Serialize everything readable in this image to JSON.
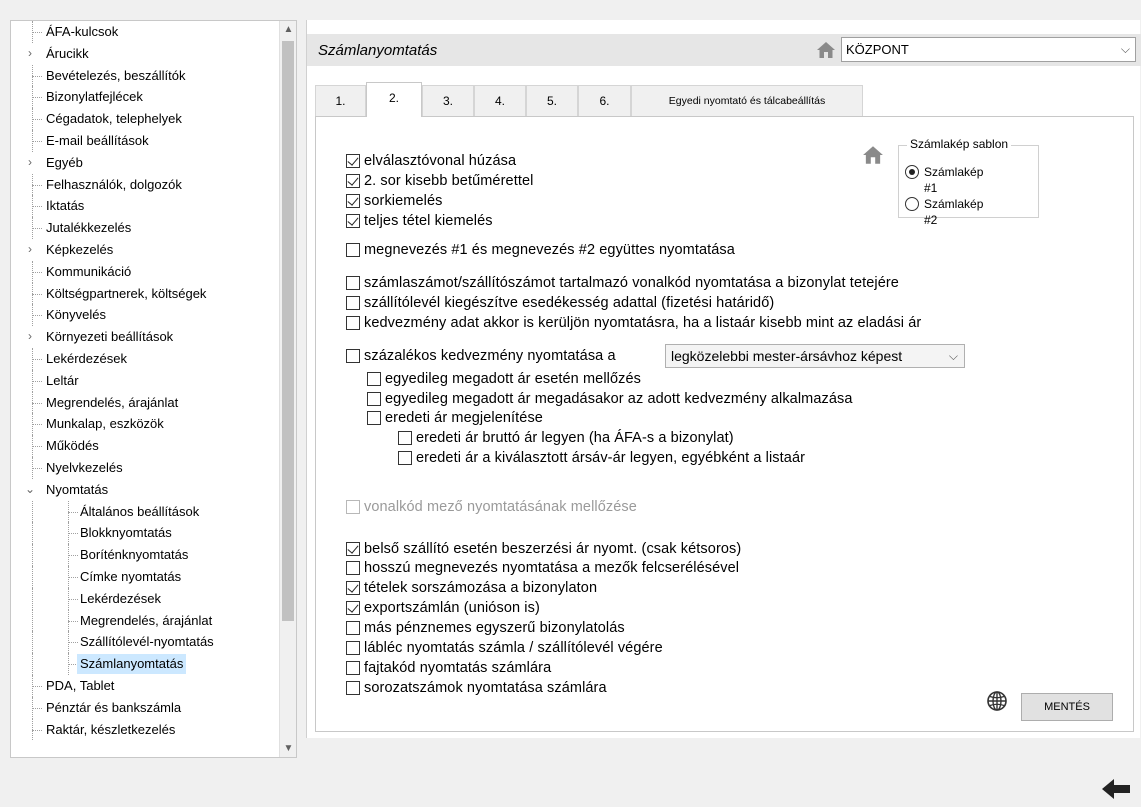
{
  "tree": {
    "items": [
      {
        "label": "ÁFA-kulcsok",
        "level": 0,
        "expander": ""
      },
      {
        "label": "Árucikk",
        "level": 0,
        "expander": "›"
      },
      {
        "label": "Bevételezés, beszállítók",
        "level": 0,
        "expander": ""
      },
      {
        "label": "Bizonylatfejlécek",
        "level": 0,
        "expander": ""
      },
      {
        "label": "Cégadatok, telephelyek",
        "level": 0,
        "expander": ""
      },
      {
        "label": "E-mail beállítások",
        "level": 0,
        "expander": ""
      },
      {
        "label": "Egyéb",
        "level": 0,
        "expander": "›"
      },
      {
        "label": "Felhasználók, dolgozók",
        "level": 0,
        "expander": ""
      },
      {
        "label": "Iktatás",
        "level": 0,
        "expander": ""
      },
      {
        "label": "Jutalékkezelés",
        "level": 0,
        "expander": ""
      },
      {
        "label": "Képkezelés",
        "level": 0,
        "expander": "›"
      },
      {
        "label": "Kommunikáció",
        "level": 0,
        "expander": ""
      },
      {
        "label": "Költségpartnerek, költségek",
        "level": 0,
        "expander": ""
      },
      {
        "label": "Könyvelés",
        "level": 0,
        "expander": ""
      },
      {
        "label": "Környezeti beállítások",
        "level": 0,
        "expander": "›"
      },
      {
        "label": "Lekérdezések",
        "level": 0,
        "expander": ""
      },
      {
        "label": "Leltár",
        "level": 0,
        "expander": ""
      },
      {
        "label": "Megrendelés, árajánlat",
        "level": 0,
        "expander": ""
      },
      {
        "label": "Munkalap, eszközök",
        "level": 0,
        "expander": ""
      },
      {
        "label": "Működés",
        "level": 0,
        "expander": ""
      },
      {
        "label": "Nyelvkezelés",
        "level": 0,
        "expander": ""
      },
      {
        "label": "Nyomtatás",
        "level": 0,
        "expander": "⌄"
      },
      {
        "label": "Általános beállítások",
        "level": 1,
        "expander": ""
      },
      {
        "label": "Blokknyomtatás",
        "level": 1,
        "expander": ""
      },
      {
        "label": "Boríténknyomtatás",
        "level": 1,
        "expander": ""
      },
      {
        "label": "Címke nyomtatás",
        "level": 1,
        "expander": ""
      },
      {
        "label": "Lekérdezések",
        "level": 1,
        "expander": ""
      },
      {
        "label": "Megrendelés, árajánlat",
        "level": 1,
        "expander": ""
      },
      {
        "label": "Szállítólevél-nyomtatás",
        "level": 1,
        "expander": ""
      },
      {
        "label": "Számlanyomtatás",
        "level": 1,
        "expander": "",
        "selected": true
      },
      {
        "label": "PDA, Tablet",
        "level": 0,
        "expander": ""
      },
      {
        "label": "Pénztár és bankszámla",
        "level": 0,
        "expander": ""
      },
      {
        "label": "Raktár, készletkezelés",
        "level": 0,
        "expander": ""
      }
    ]
  },
  "header": {
    "title": "Számlanyomtatás",
    "branch_value": "KÖZPONT"
  },
  "tabs": [
    {
      "label": "1."
    },
    {
      "label": "2.",
      "active": true
    },
    {
      "label": "3."
    },
    {
      "label": "4."
    },
    {
      "label": "5."
    },
    {
      "label": "6."
    },
    {
      "label": "Egyedi nyomtató és tálcabeállítás"
    }
  ],
  "options": {
    "separator_line": {
      "label": "elválasztóvonal húzása",
      "checked": true
    },
    "second_row_smaller": {
      "label": "2. sor kisebb betűmérettel",
      "checked": true
    },
    "row_highlight": {
      "label": "sorkiemelés",
      "checked": true
    },
    "full_item_highlight": {
      "label": "teljes tétel kiemelés",
      "checked": true
    },
    "name1_name2_together": {
      "label": "megnevezés #1 és megnevezés #2 együttes nyomtatása",
      "checked": false
    },
    "barcode_top": {
      "label": "számlaszámot/szállítószámot tartalmazó vonalkód nyomtatása a bizonylat tetejére",
      "checked": false
    },
    "delivery_due_date": {
      "label": "szállítólevél kiegészítve esedékesség adattal (fizetési határidő)",
      "checked": false
    },
    "discount_always": {
      "label": "kedvezmény adat akkor is kerüljön nyomtatásra, ha a listaár kisebb mint az eladási ár",
      "checked": false
    },
    "percent_discount": {
      "label": "százalékos kedvezmény nyomtatása a",
      "checked": false,
      "select_value": "legközelebbi mester-ársávhoz képest"
    },
    "skip_custom_price": {
      "label": "egyedileg megadott ár esetén mellőzés",
      "checked": false
    },
    "apply_discount_custom": {
      "label": "egyedileg megadott ár megadásakor az adott kedvezmény alkalmazása",
      "checked": false
    },
    "show_original_price": {
      "label": "eredeti ár megjelenítése",
      "checked": false
    },
    "original_gross": {
      "label": "eredeti ár bruttó ár legyen (ha ÁFA-s a bizonylat)",
      "checked": false
    },
    "original_band": {
      "label": "eredeti ár a kiválasztott ársáv-ár legyen, egyébként a listaár",
      "checked": false
    },
    "skip_barcode_field": {
      "label": "vonalkód mező nyomtatásának mellőzése",
      "checked": false,
      "disabled": true
    },
    "internal_supplier": {
      "label": "belső szállító esetén beszerzési ár nyomt. (csak kétsoros)",
      "checked": true
    },
    "long_name_swap": {
      "label": "hosszú megnevezés nyomtatása a mezők felcserélésével",
      "checked": false
    },
    "item_numbering": {
      "label": "tételek sorszámozása a bizonylaton",
      "checked": true
    },
    "export_invoice": {
      "label": "exportszámlán (unióson is)",
      "checked": true
    },
    "other_currency": {
      "label": "más pénznemes egyszerű bizonylatolás",
      "checked": false
    },
    "footer_print": {
      "label": "lábléc nyomtatás számla / szállítólevél végére",
      "checked": false
    },
    "breed_code": {
      "label": "fajtakód nyomtatás számlára",
      "checked": false
    },
    "serial_numbers": {
      "label": "sorozatszámok nyomtatása számlára",
      "checked": false
    }
  },
  "template": {
    "legend": "Számlakép sablon",
    "option1": "Számlakép #1",
    "option2": "Számlakép #2",
    "selected": "option1"
  },
  "footer": {
    "save_label": "MENTÉS"
  },
  "icons": {
    "home": "home-icon",
    "globe": "globe-icon",
    "back": "back-arrow-icon"
  }
}
